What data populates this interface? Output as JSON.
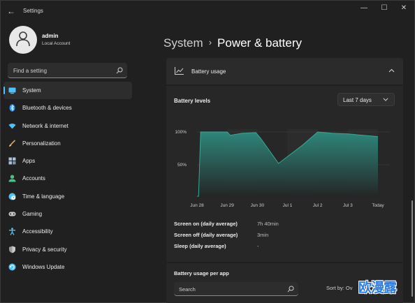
{
  "window": {
    "title": "Settings",
    "controls": {
      "minimize": "—",
      "maximize": "☐",
      "close": "✕"
    }
  },
  "profile": {
    "name": "admin",
    "account_type": "Local Account"
  },
  "sidebar": {
    "search_placeholder": "Find a setting",
    "items": [
      {
        "label": "System",
        "icon": "system-icon",
        "color": "#4cc2ff",
        "active": true
      },
      {
        "label": "Bluetooth & devices",
        "icon": "bluetooth-icon",
        "color": "#2f8fe8"
      },
      {
        "label": "Network & internet",
        "icon": "wifi-icon",
        "color": "#4cc2ff"
      },
      {
        "label": "Personalization",
        "icon": "brush-icon",
        "color": "#e8a25e"
      },
      {
        "label": "Apps",
        "icon": "apps-icon",
        "color": "#a9bfd8"
      },
      {
        "label": "Accounts",
        "icon": "accounts-icon",
        "color": "#3fc48a"
      },
      {
        "label": "Time & language",
        "icon": "globe-clock-icon",
        "color": "#4cc2ff"
      },
      {
        "label": "Gaming",
        "icon": "gamepad-icon",
        "color": "#c9c9c9"
      },
      {
        "label": "Accessibility",
        "icon": "accessibility-icon",
        "color": "#4cc2ff"
      },
      {
        "label": "Privacy & security",
        "icon": "shield-icon",
        "color": "#9a9a9a"
      },
      {
        "label": "Windows Update",
        "icon": "update-icon",
        "color": "#4cc2ff"
      }
    ]
  },
  "main": {
    "breadcrumb_parent": "System",
    "breadcrumb_sep": "›",
    "page_title": "Power & battery",
    "battery_usage": {
      "title": "Battery usage",
      "levels_label": "Battery levels",
      "range": "Last 7 days",
      "stats": [
        {
          "label": "Screen on (daily average)",
          "value": "7h 40min"
        },
        {
          "label": "Screen off (daily average)",
          "value": "3min"
        },
        {
          "label": "Sleep (daily average)",
          "value": "-"
        }
      ]
    },
    "per_app": {
      "title": "Battery usage per app",
      "search_placeholder": "Search",
      "sort_label": "Sort by: Ov"
    }
  },
  "chart_data": {
    "type": "area",
    "x_ticks": [
      "Jun 28",
      "Jun 29",
      "Jun 30",
      "Jul 1",
      "Jul 2",
      "Jul 3",
      "Today"
    ],
    "y_ticks": [
      "100%",
      "50%"
    ],
    "ylim": [
      0,
      100
    ],
    "series": [
      {
        "x": [
          0.0,
          0.05,
          0.12,
          1.0,
          1.1,
          1.5,
          1.95,
          2.1,
          2.7,
          3.5,
          4.0,
          4.5,
          5.0,
          5.5,
          6.0
        ],
        "values": [
          2,
          2,
          100,
          100,
          95,
          98,
          99,
          91,
          52,
          80,
          100,
          98,
          97,
          95,
          93
        ]
      }
    ],
    "colors": {
      "area_top": "#2e8b7f",
      "area_bottom": "#242424",
      "line": "#3aa594",
      "grid": "#3a3a3a"
    }
  },
  "watermark": "欧漫露"
}
